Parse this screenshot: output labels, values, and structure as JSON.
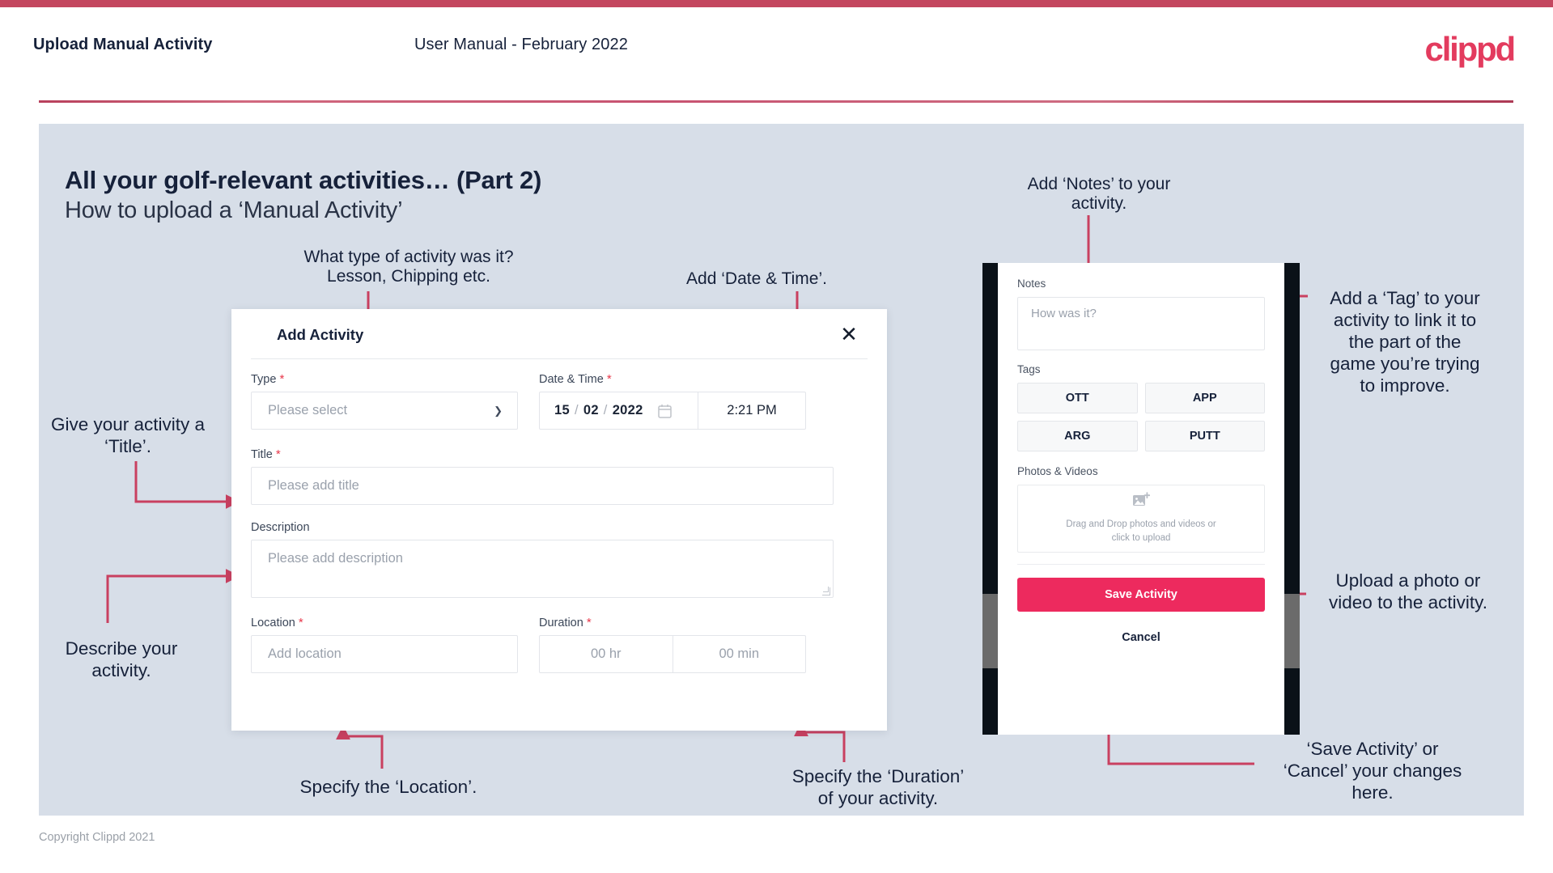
{
  "header": {
    "title": "Upload Manual Activity",
    "subtitle": "User Manual - February 2022",
    "logo": "clippd"
  },
  "slide": {
    "title": "All your golf-relevant activities… (Part 2)",
    "subtitle": "How to upload a ‘Manual Activity’"
  },
  "annotations": {
    "type": "What type of activity was it?\nLesson, Chipping etc.",
    "date_time": "Add ‘Date & Time’.",
    "notes": "Add ‘Notes’ to your\nactivity.",
    "tag": "Add a ‘Tag’ to your\nactivity to link it to\nthe part of the\ngame you’re trying\nto improve.",
    "title": "Give your activity a\n‘Title’.",
    "description": "Describe your\nactivity.",
    "location": "Specify the ‘Location’.",
    "duration": "Specify the ‘Duration’\nof your activity.",
    "upload": "Upload a photo or\nvideo to the activity.",
    "save_cancel": "‘Save Activity’ or\n‘Cancel’ your changes\nhere."
  },
  "dialog": {
    "title": "Add Activity",
    "close_icon": "close-icon",
    "fields": {
      "type": {
        "label": "Type",
        "required": true,
        "placeholder": "Please select",
        "value": ""
      },
      "date_time": {
        "label": "Date & Time",
        "required": true,
        "day": "15",
        "month": "02",
        "year": "2022",
        "separator": "/",
        "time": "2:21 PM",
        "calendar_icon": "calendar-icon"
      },
      "title": {
        "label": "Title",
        "required": true,
        "placeholder": "Please add title",
        "value": ""
      },
      "description": {
        "label": "Description",
        "required": false,
        "placeholder": "Please add description",
        "value": ""
      },
      "location": {
        "label": "Location",
        "required": true,
        "placeholder": "Add location",
        "value": ""
      },
      "duration": {
        "label": "Duration",
        "required": true,
        "hours": "00 hr",
        "minutes": "00 min"
      }
    }
  },
  "phone": {
    "notes": {
      "label": "Notes",
      "placeholder": "How was it?"
    },
    "tags": {
      "label": "Tags",
      "items": [
        "OTT",
        "APP",
        "ARG",
        "PUTT"
      ]
    },
    "media": {
      "label": "Photos & Videos",
      "icon": "add-image-icon",
      "drop_text": "Drag and Drop photos and videos or\nclick to upload"
    },
    "save_label": "Save Activity",
    "cancel_label": "Cancel"
  },
  "footer": {
    "copyright": "Copyright Clippd 2021"
  },
  "colors": {
    "accent": "#c4475f",
    "brand_pink": "#e33b5e",
    "save_button": "#ed2a5e",
    "slide_bg": "#d7dee8",
    "text_dark": "#16213a",
    "required_star": "#e8374a",
    "arrow": "#c94060"
  }
}
